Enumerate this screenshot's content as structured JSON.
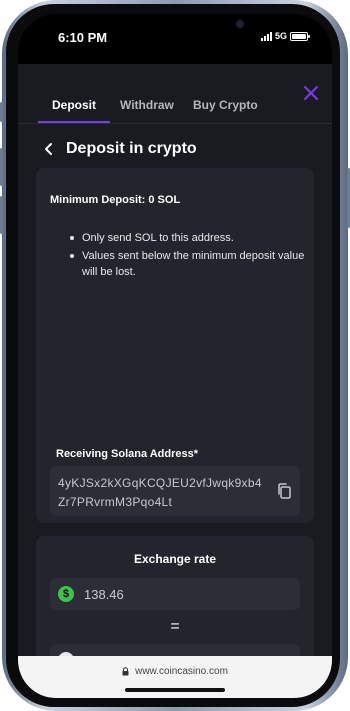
{
  "status_bar": {
    "time": "6:10 PM",
    "network": "5G",
    "icons": [
      "signal-icon",
      "battery-icon"
    ]
  },
  "tabs": [
    {
      "label": "Deposit",
      "active": true
    },
    {
      "label": "Withdraw",
      "active": false
    },
    {
      "label": "Buy Crypto",
      "active": false
    }
  ],
  "header": {
    "title": "Deposit in crypto"
  },
  "deposit": {
    "minimum_label": "Minimum Deposit: 0 SOL",
    "notes": [
      "Only send SOL to this address.",
      "Values sent below the minimum deposit value will be lost."
    ],
    "address_label": "Receiving Solana Address*",
    "address": "4yKJSx2kXGqKCQJEU2vfJwqk9xb4Zr7PRvrmM3Pqo4Lt"
  },
  "exchange": {
    "title": "Exchange rate",
    "usd_value": "138.46",
    "equals": "="
  },
  "browser": {
    "url": "www.coincasino.com"
  },
  "colors": {
    "accent": "#7c3aed",
    "background": "#1a1b21",
    "card": "#23242c",
    "dollar": "#3cc44b"
  }
}
